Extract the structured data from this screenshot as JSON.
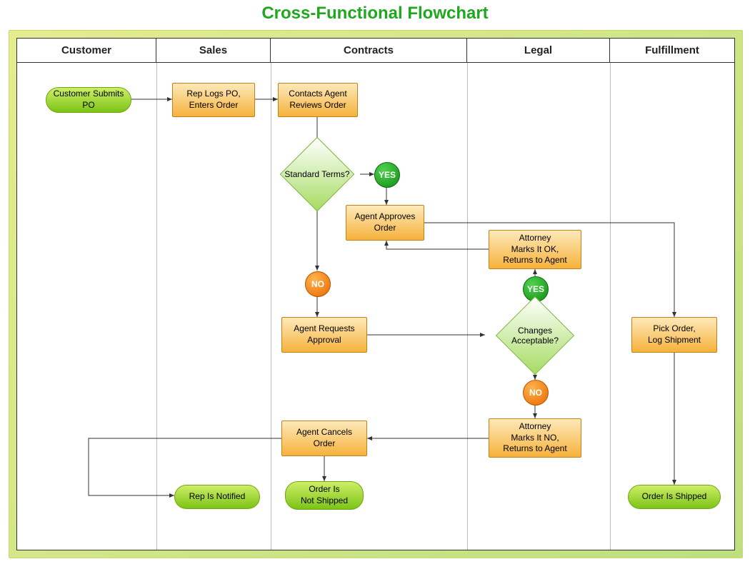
{
  "title": "Cross-Functional Flowchart",
  "lanes": [
    "Customer",
    "Sales",
    "Contracts",
    "Legal",
    "Fulfillment"
  ],
  "nodes": {
    "customerSubmits": "Customer Submits\nPO",
    "repLogs": "Rep Logs PO,\nEnters Order",
    "agentReviews": "Contacts Agent\nReviews Order",
    "standardTerms": "Standard Terms?",
    "yes1": "YES",
    "agentApproves": "Agent Approves\nOrder",
    "no1": "NO",
    "agentRequests": "Agent Requests\nApproval",
    "changesAcceptable": "Changes\nAcceptable?",
    "yes2": "YES",
    "attorneyOK": "Attorney\nMarks It OK,\nReturns to Agent",
    "no2": "NO",
    "attorneyNO": "Attorney\nMarks It NO,\nReturns to Agent",
    "agentCancels": "Agent Cancels\nOrder",
    "repNotified": "Rep Is Notified",
    "orderNotShipped": "Order Is\nNot Shipped",
    "pickOrder": "Pick Order,\nLog Shipment",
    "orderShipped": "Order Is Shipped"
  },
  "flow": [
    [
      "customerSubmits",
      "repLogs"
    ],
    [
      "repLogs",
      "agentReviews"
    ],
    [
      "agentReviews",
      "standardTerms"
    ],
    [
      "standardTerms",
      "yes1",
      "agentApproves"
    ],
    [
      "standardTerms",
      "no1",
      "agentRequests"
    ],
    [
      "agentApproves",
      "pickOrder"
    ],
    [
      "agentRequests",
      "changesAcceptable"
    ],
    [
      "changesAcceptable",
      "yes2",
      "attorneyOK"
    ],
    [
      "attorneyOK",
      "agentApproves"
    ],
    [
      "changesAcceptable",
      "no2",
      "attorneyNO"
    ],
    [
      "attorneyNO",
      "agentCancels"
    ],
    [
      "agentCancels",
      "repNotified"
    ],
    [
      "agentCancels",
      "orderNotShipped"
    ],
    [
      "pickOrder",
      "orderShipped"
    ]
  ]
}
